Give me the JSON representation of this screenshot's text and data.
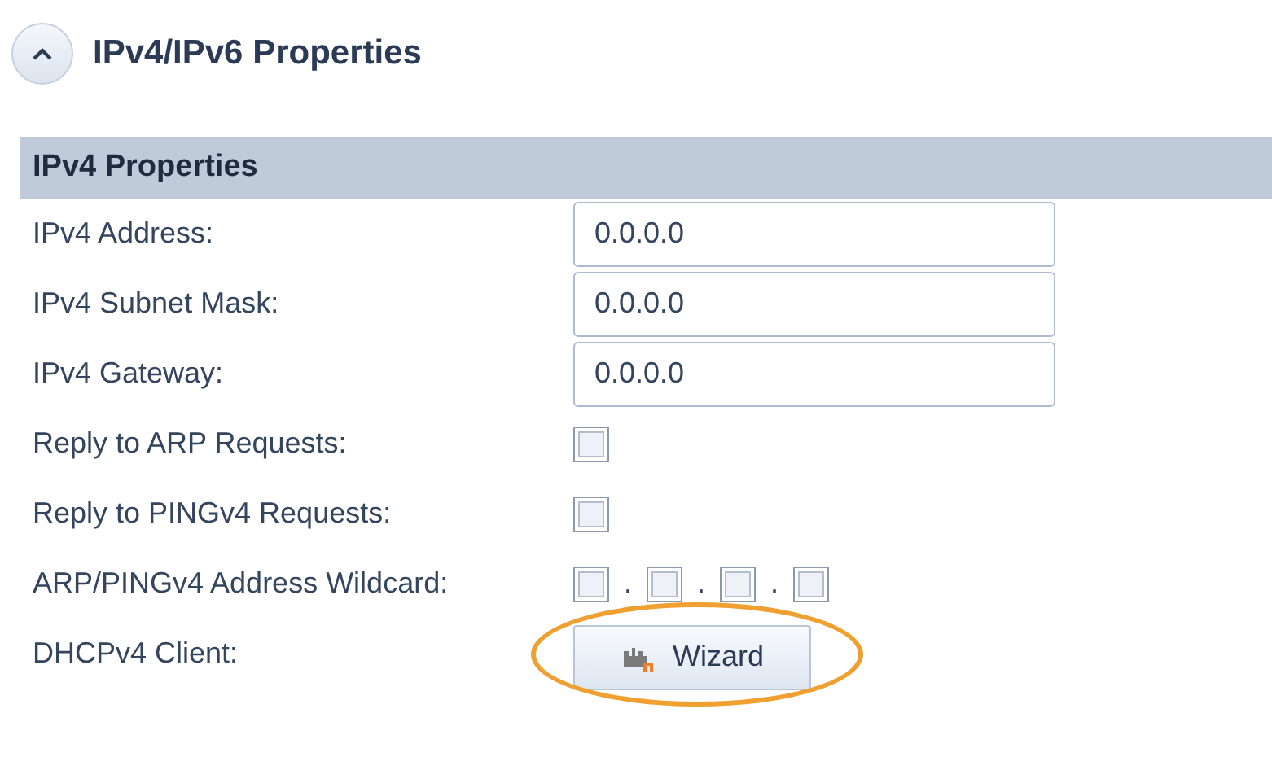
{
  "group": {
    "title": "IPv4/IPv6 Properties",
    "expanded": true
  },
  "section": {
    "title": "IPv4 Properties"
  },
  "rows": [
    {
      "kind": "text",
      "label": "IPv4 Address:",
      "value": "0.0.0.0"
    },
    {
      "kind": "text",
      "label": "IPv4 Subnet Mask:",
      "value": "0.0.0.0"
    },
    {
      "kind": "text",
      "label": "IPv4 Gateway:",
      "value": "0.0.0.0"
    },
    {
      "kind": "checkbox",
      "label": "Reply to ARP Requests:",
      "checked": false
    },
    {
      "kind": "checkbox",
      "label": "Reply to PINGv4 Requests:",
      "checked": false
    },
    {
      "kind": "wildcard",
      "label": "ARP/PINGv4 Address Wildcard:",
      "octets": [
        {
          "checked": false,
          "separator": "."
        },
        {
          "checked": false,
          "separator": "."
        },
        {
          "checked": false,
          "separator": "."
        },
        {
          "checked": false
        }
      ]
    },
    {
      "kind": "button",
      "label": "DHCPv4 Client:",
      "button": "Wizard",
      "highlighted": true
    }
  ]
}
